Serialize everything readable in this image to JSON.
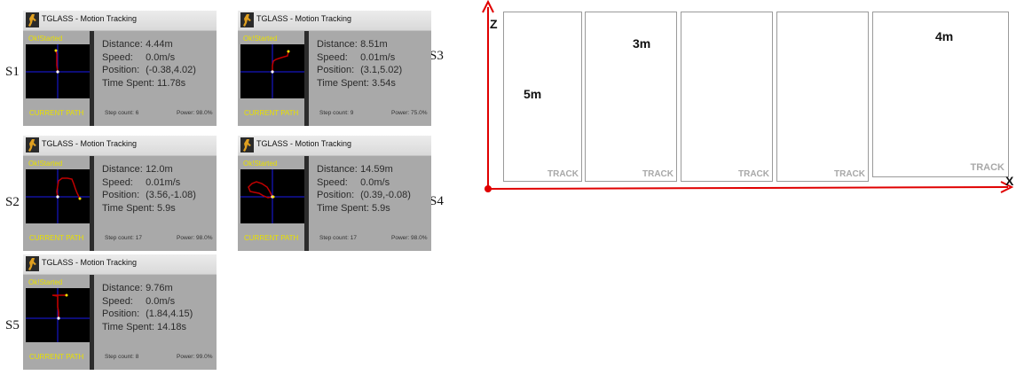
{
  "app": {
    "title": "TGLASS - Motion Tracking",
    "status": "Ok!Started",
    "current_path_label": "CURRENT PATH",
    "labels": {
      "distance": "Distance:",
      "speed": "Speed:",
      "position": "Position:",
      "time_spent": "Time Spent:",
      "step_count": "Step count:",
      "power": "Power:"
    }
  },
  "screens": [
    {
      "id": "S1",
      "distance": "4.44m",
      "speed": "0.0m/s",
      "position": "(-0.38,4.02)",
      "time_spent": "11.78s",
      "step_count": "6",
      "power": "98.0%"
    },
    {
      "id": "S3",
      "distance": "8.51m",
      "speed": "0.01m/s",
      "position": "(3.1,5.02)",
      "time_spent": "3.54s",
      "step_count": "9",
      "power": "75.0%"
    },
    {
      "id": "S2",
      "distance": "12.0m",
      "speed": "0.01m/s",
      "position": "(3.56,-1.08)",
      "time_spent": "5.9s",
      "step_count": "17",
      "power": "98.0%"
    },
    {
      "id": "S4",
      "distance": "14.59m",
      "speed": "0.0m/s",
      "position": "(0.39,-0.08)",
      "time_spent": "5.9s",
      "step_count": "17",
      "power": "98.0%"
    },
    {
      "id": "S5",
      "distance": "9.76m",
      "speed": "0.0m/s",
      "position": "(1.84,4.15)",
      "time_spent": "14.18s",
      "step_count": "8",
      "power": "99.0%"
    }
  ],
  "diagram": {
    "axis_z": "Z",
    "axis_x": "X",
    "track_label": "TRACK",
    "dims": {
      "p1": "5m",
      "p2": "3m",
      "p5": "4m"
    }
  },
  "colors": {
    "path": "#c00000",
    "status_text": "#e8e000",
    "panel_bg": "#a9a9a9",
    "axis": "#e00000",
    "crosshair": "#1a1aee"
  }
}
